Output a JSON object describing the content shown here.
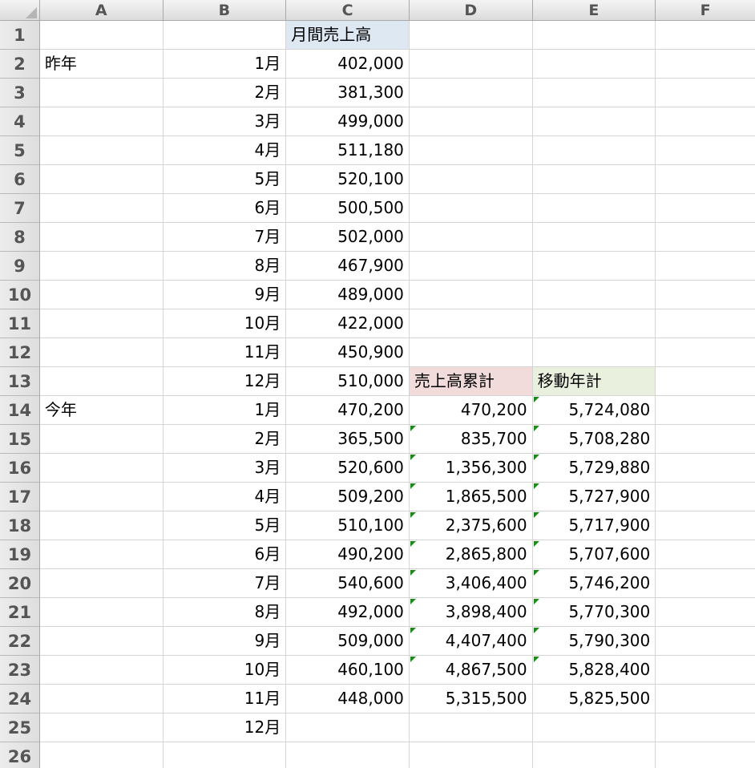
{
  "columns": [
    "A",
    "B",
    "C",
    "D",
    "E",
    "F"
  ],
  "rows": [
    {
      "num": "1",
      "A": "",
      "B": "",
      "C": "月間売上高",
      "D": "",
      "E": "",
      "F": ""
    },
    {
      "num": "2",
      "A": "昨年",
      "B": "1月",
      "C": "402,000",
      "D": "",
      "E": "",
      "F": ""
    },
    {
      "num": "3",
      "A": "",
      "B": "2月",
      "C": "381,300",
      "D": "",
      "E": "",
      "F": ""
    },
    {
      "num": "4",
      "A": "",
      "B": "3月",
      "C": "499,000",
      "D": "",
      "E": "",
      "F": ""
    },
    {
      "num": "5",
      "A": "",
      "B": "4月",
      "C": "511,180",
      "D": "",
      "E": "",
      "F": ""
    },
    {
      "num": "6",
      "A": "",
      "B": "5月",
      "C": "520,100",
      "D": "",
      "E": "",
      "F": ""
    },
    {
      "num": "7",
      "A": "",
      "B": "6月",
      "C": "500,500",
      "D": "",
      "E": "",
      "F": ""
    },
    {
      "num": "8",
      "A": "",
      "B": "7月",
      "C": "502,000",
      "D": "",
      "E": "",
      "F": ""
    },
    {
      "num": "9",
      "A": "",
      "B": "8月",
      "C": "467,900",
      "D": "",
      "E": "",
      "F": ""
    },
    {
      "num": "10",
      "A": "",
      "B": "9月",
      "C": "489,000",
      "D": "",
      "E": "",
      "F": ""
    },
    {
      "num": "11",
      "A": "",
      "B": "10月",
      "C": "422,000",
      "D": "",
      "E": "",
      "F": ""
    },
    {
      "num": "12",
      "A": "",
      "B": "11月",
      "C": "450,900",
      "D": "",
      "E": "",
      "F": ""
    },
    {
      "num": "13",
      "A": "",
      "B": "12月",
      "C": "510,000",
      "D": "売上高累計",
      "E": "移動年計",
      "F": ""
    },
    {
      "num": "14",
      "A": "今年",
      "B": "1月",
      "C": "470,200",
      "D": "470,200",
      "E": "5,724,080",
      "F": ""
    },
    {
      "num": "15",
      "A": "",
      "B": "2月",
      "C": "365,500",
      "D": "835,700",
      "E": "5,708,280",
      "F": ""
    },
    {
      "num": "16",
      "A": "",
      "B": "3月",
      "C": "520,600",
      "D": "1,356,300",
      "E": "5,729,880",
      "F": ""
    },
    {
      "num": "17",
      "A": "",
      "B": "4月",
      "C": "509,200",
      "D": "1,865,500",
      "E": "5,727,900",
      "F": ""
    },
    {
      "num": "18",
      "A": "",
      "B": "5月",
      "C": "510,100",
      "D": "2,375,600",
      "E": "5,717,900",
      "F": ""
    },
    {
      "num": "19",
      "A": "",
      "B": "6月",
      "C": "490,200",
      "D": "2,865,800",
      "E": "5,707,600",
      "F": ""
    },
    {
      "num": "20",
      "A": "",
      "B": "7月",
      "C": "540,600",
      "D": "3,406,400",
      "E": "5,746,200",
      "F": ""
    },
    {
      "num": "21",
      "A": "",
      "B": "8月",
      "C": "492,000",
      "D": "3,898,400",
      "E": "5,770,300",
      "F": ""
    },
    {
      "num": "22",
      "A": "",
      "B": "9月",
      "C": "509,000",
      "D": "4,407,400",
      "E": "5,790,300",
      "F": ""
    },
    {
      "num": "23",
      "A": "",
      "B": "10月",
      "C": "460,100",
      "D": "4,867,500",
      "E": "5,828,400",
      "F": ""
    },
    {
      "num": "24",
      "A": "",
      "B": "11月",
      "C": "448,000",
      "D": "5,315,500",
      "E": "5,825,500",
      "F": ""
    },
    {
      "num": "25",
      "A": "",
      "B": "12月",
      "C": "",
      "D": "",
      "E": "",
      "F": ""
    },
    {
      "num": "26",
      "A": "",
      "B": "",
      "C": "",
      "D": "",
      "E": "",
      "F": ""
    }
  ],
  "formula_flag_cells": [
    "D15",
    "D16",
    "D17",
    "D18",
    "D19",
    "D20",
    "D21",
    "D22",
    "D23",
    "E14",
    "E15",
    "E16",
    "E17",
    "E18",
    "E19",
    "E20",
    "E21",
    "E22",
    "E23"
  ],
  "header_fills": {
    "C1": "#dde8f3",
    "D13": "#f2dcdb",
    "E13": "#e9f0de"
  },
  "flag_color": "#1e8a1e"
}
